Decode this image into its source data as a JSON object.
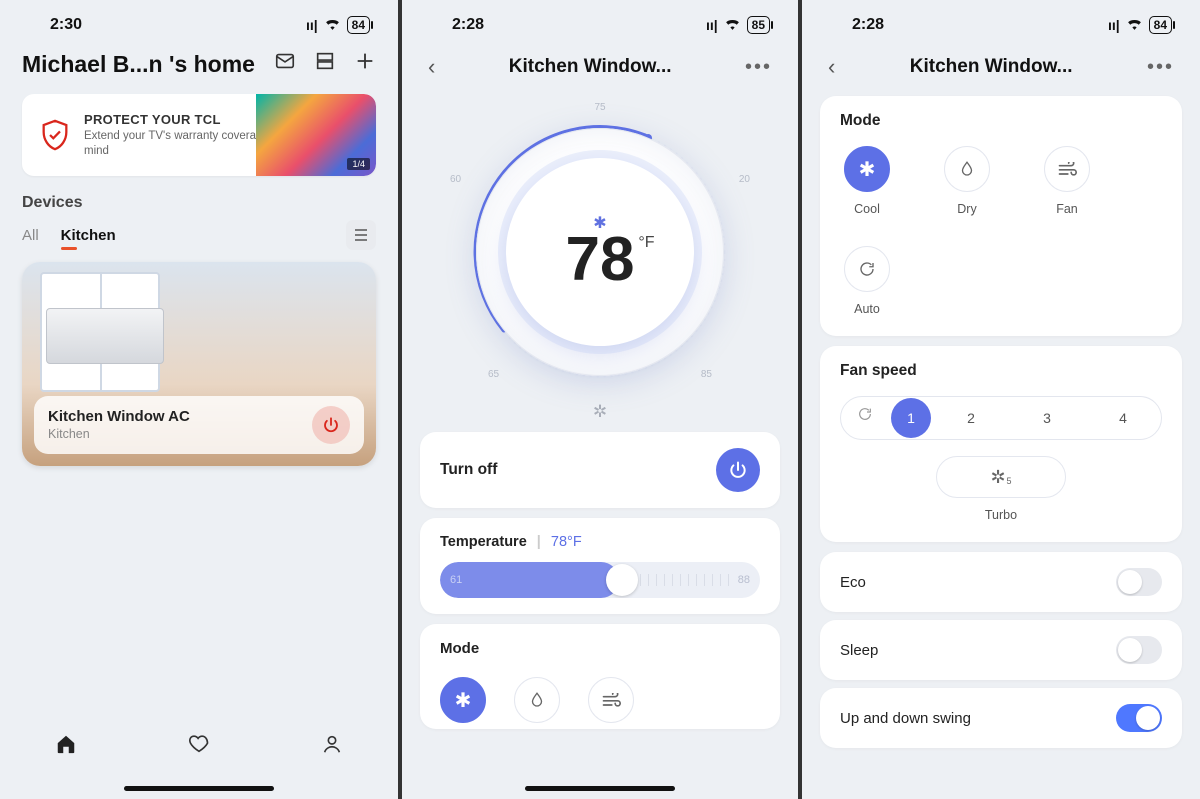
{
  "screen1": {
    "status": {
      "time": "2:30",
      "battery": "84"
    },
    "title": "Michael B...n 's home",
    "banner": {
      "headline": "PROTECT YOUR TCL",
      "sub": "Extend your TV's warranty coverage for peace of mind",
      "pager": "1/4"
    },
    "devices_label": "Devices",
    "tabs": {
      "all": "All",
      "kitchen": "Kitchen"
    },
    "device": {
      "name": "Kitchen Window AC",
      "room": "Kitchen"
    }
  },
  "screen2": {
    "status": {
      "time": "2:28",
      "battery": "85"
    },
    "title": "Kitchen Window...",
    "dial": {
      "temp": "78",
      "unit": "°F",
      "ticks": {
        "top": "75",
        "left": "60",
        "right": "20",
        "bl": "65",
        "br": "85"
      }
    },
    "turnoff_label": "Turn off",
    "temperature": {
      "label": "Temperature",
      "value": "78°F",
      "min": "61",
      "max": "88"
    },
    "mode_label": "Mode"
  },
  "screen3": {
    "status": {
      "time": "2:28",
      "battery": "84"
    },
    "title": "Kitchen Window...",
    "mode": {
      "label": "Mode",
      "items": {
        "cool": "Cool",
        "dry": "Dry",
        "fan": "Fan",
        "auto": "Auto"
      }
    },
    "fanspeed": {
      "label": "Fan speed",
      "options": [
        "1",
        "2",
        "3",
        "4"
      ],
      "turbo": "Turbo"
    },
    "toggles": {
      "eco": "Eco",
      "sleep": "Sleep",
      "swing": "Up and down swing"
    }
  },
  "colors": {
    "accent": "#5d70e6"
  }
}
